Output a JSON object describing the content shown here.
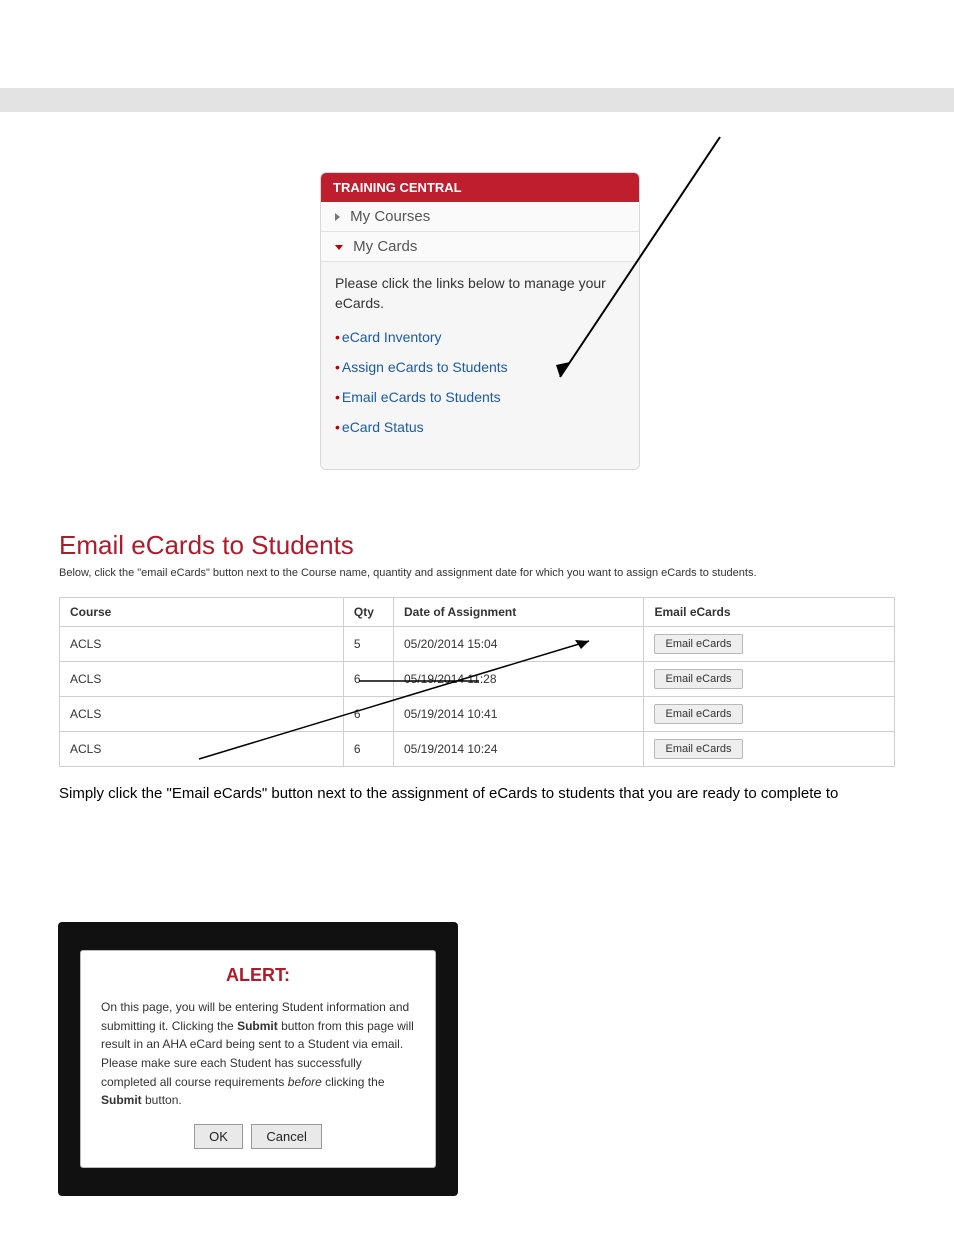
{
  "sidebar": {
    "header": "TRAINING CENTRAL",
    "myCourses": "My Courses",
    "myCards": "My Cards",
    "desc": "Please click the links below to manage your eCards.",
    "links": {
      "inventory": "eCard Inventory",
      "assign": "Assign eCards to Students",
      "email": "Email eCards to Students",
      "status": "eCard Status"
    }
  },
  "section": {
    "title": "Email eCards to Students",
    "desc": "Below, click the \"email eCards\" button next to the Course name, quantity and assignment date for which you want to assign eCards to students.",
    "headers": {
      "course": "Course",
      "qty": "Qty",
      "date": "Date of Assignment",
      "email": "Email eCards"
    },
    "btn": "Email eCards",
    "rows": [
      {
        "course": "ACLS",
        "qty": "5",
        "date": "05/20/2014 15:04"
      },
      {
        "course": "ACLS",
        "qty": "6",
        "date": "05/19/2014 11:28"
      },
      {
        "course": "ACLS",
        "qty": "6",
        "date": "05/19/2014 10:41"
      },
      {
        "course": "ACLS",
        "qty": "6",
        "date": "05/19/2014 10:24"
      }
    ]
  },
  "explain": "Simply click the \"Email eCards\" button next to the assignment of eCards to students that you are ready to complete to",
  "alert": {
    "title": "ALERT:",
    "body_pre": "On this page, you will be entering Student information and submitting it. Clicking the ",
    "body_b1": "Submit",
    "body_mid": " button from this page will result in an AHA eCard being sent to a Student via email. Please make sure each Student has successfully completed all course requirements ",
    "body_i": "before",
    "body_post": " clicking the ",
    "body_b2": "Submit",
    "body_end": " button.",
    "ok": "OK",
    "cancel": "Cancel"
  }
}
